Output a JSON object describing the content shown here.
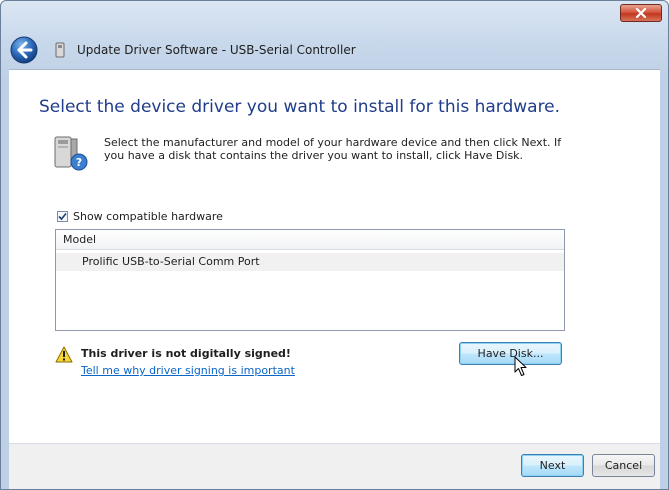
{
  "window": {
    "title": "Update Driver Software - USB-Serial Controller"
  },
  "titlebar": {
    "close_icon": "close-x-icon"
  },
  "header": {
    "back_icon": "back-arrow-icon",
    "device_icon": "usb-device-icon"
  },
  "main": {
    "instruction": "Select the device driver you want to install for this hardware.",
    "description": "Select the manufacturer and model of your hardware device and then click Next. If you have a disk that contains the driver you want to install, click Have Disk.",
    "show_compatible": {
      "label": "Show compatible hardware",
      "checked": true
    },
    "model_list": {
      "header": "Model",
      "items": [
        "Prolific USB-to-Serial Comm Port"
      ]
    },
    "warning": {
      "text": "This driver is not digitally signed!",
      "link": "Tell me why driver signing is important",
      "icon": "warning-triangle-icon"
    },
    "have_disk_label": "Have Disk..."
  },
  "footer": {
    "next_label": "Next",
    "cancel_label": "Cancel"
  },
  "colors": {
    "instruction": "#1f3d8a",
    "link": "#0b66c7",
    "close_button": "#c2371f"
  }
}
